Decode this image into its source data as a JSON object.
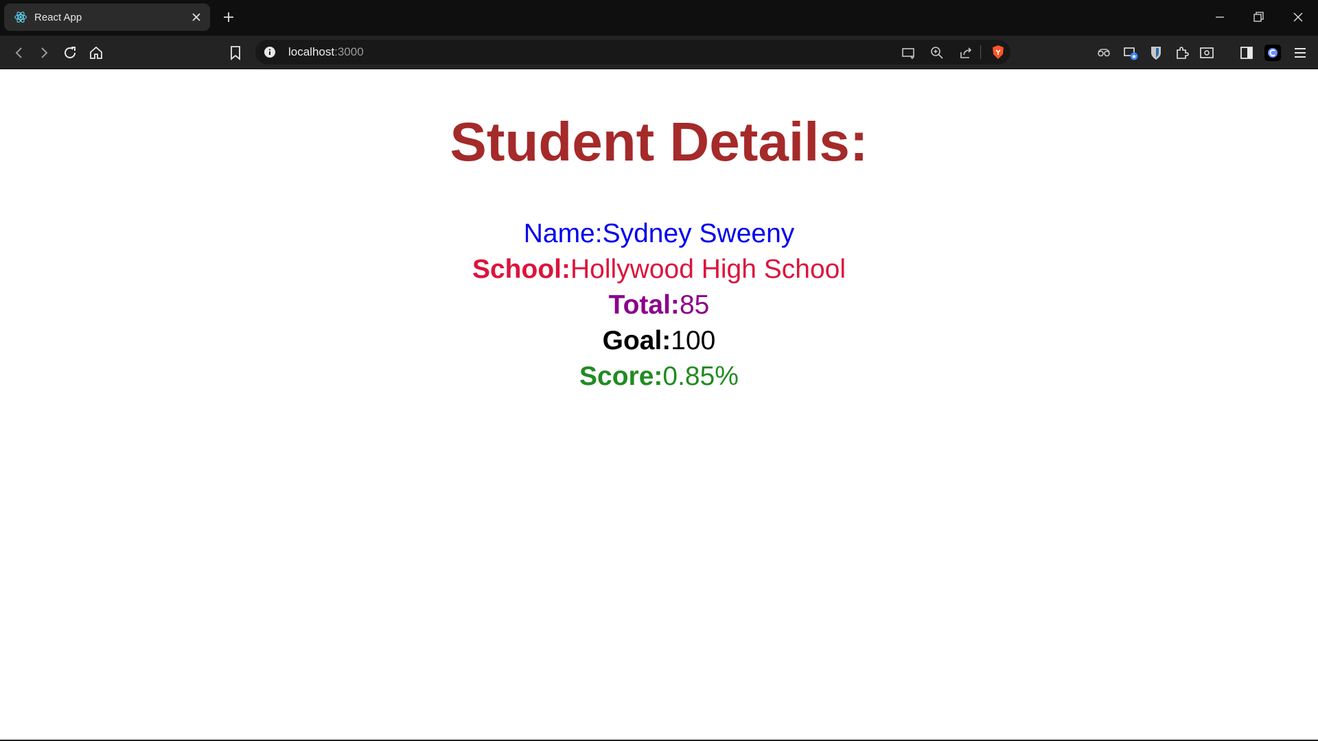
{
  "browser": {
    "tab": {
      "title": "React App"
    },
    "url": {
      "host": "localhost",
      "port": ":3000"
    }
  },
  "page": {
    "heading": "Student Details:",
    "name": {
      "label": "Name:",
      "value": "Sydney Sweeny"
    },
    "school": {
      "label": "School:",
      "value": "Hollywood High School"
    },
    "total": {
      "label": "Total:",
      "value": "85"
    },
    "goal": {
      "label": "Goal:",
      "value": "100"
    },
    "score": {
      "label": "Score:",
      "value": "0.85%"
    }
  },
  "colors": {
    "heading": "#a52a2a",
    "name": "#0000ee",
    "school": "#dc143c",
    "total": "#8b008b",
    "goal": "#000000",
    "score": "#228b22"
  }
}
